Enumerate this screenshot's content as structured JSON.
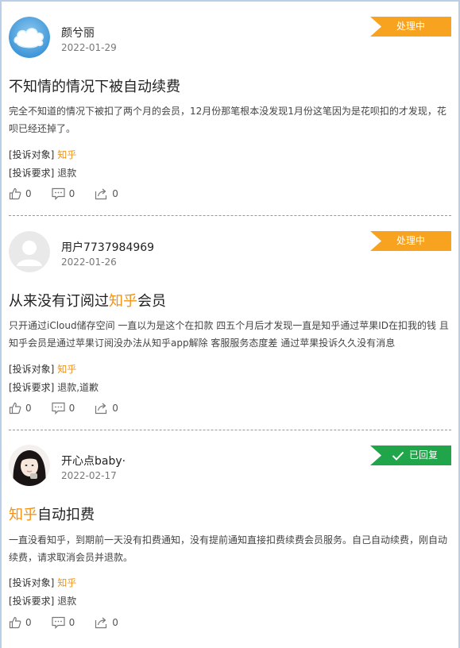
{
  "colors": {
    "accent": "#f39316",
    "processing": "#f8a31f",
    "replied": "#21a54a"
  },
  "posts": [
    {
      "user": "颜兮丽",
      "date": "2022-01-29",
      "status": "处理中",
      "title_pre": "不知情的情况下被自动续费",
      "title_hl": "",
      "title_post": "",
      "desc": "完全不知道的情况下被扣了两个月的会员，12月份那笔根本没发现1月份这笔因为是花呗扣的才发现，花呗已经还掉了。",
      "target_label": "[投诉对象]",
      "target": "知乎",
      "request_label": "[投诉要求]",
      "request": "退款",
      "likes": "0",
      "comments": "0",
      "shares": "0"
    },
    {
      "user": "用户7737984969",
      "date": "2022-01-26",
      "status": "处理中",
      "title_pre": "从来没有订阅过",
      "title_hl": "知乎",
      "title_post": "会员",
      "desc": "只开通过iCloud储存空间 一直以为是这个在扣款 四五个月后才发现一直是知乎通过苹果ID在扣我的钱 且知乎会员是通过苹果订阅没办法从知乎app解除 客服服务态度差 通过苹果投诉久久没有消息",
      "target_label": "[投诉对象]",
      "target": "知乎",
      "request_label": "[投诉要求]",
      "request": "退款,道歉",
      "likes": "0",
      "comments": "0",
      "shares": "0"
    },
    {
      "user": "开心点baby·",
      "date": "2022-02-17",
      "status": "已回复",
      "title_pre": "",
      "title_hl": "知乎",
      "title_post": "自动扣费",
      "desc": "一直没看知乎，到期前一天没有扣费通知，没有提前通知直接扣费续费会员服务。自己自动续费，刚自动续费，请求取消会员并退款。",
      "target_label": "[投诉对象]",
      "target": "知乎",
      "request_label": "[投诉要求]",
      "request": "退款",
      "likes": "0",
      "comments": "0",
      "shares": "0"
    }
  ]
}
